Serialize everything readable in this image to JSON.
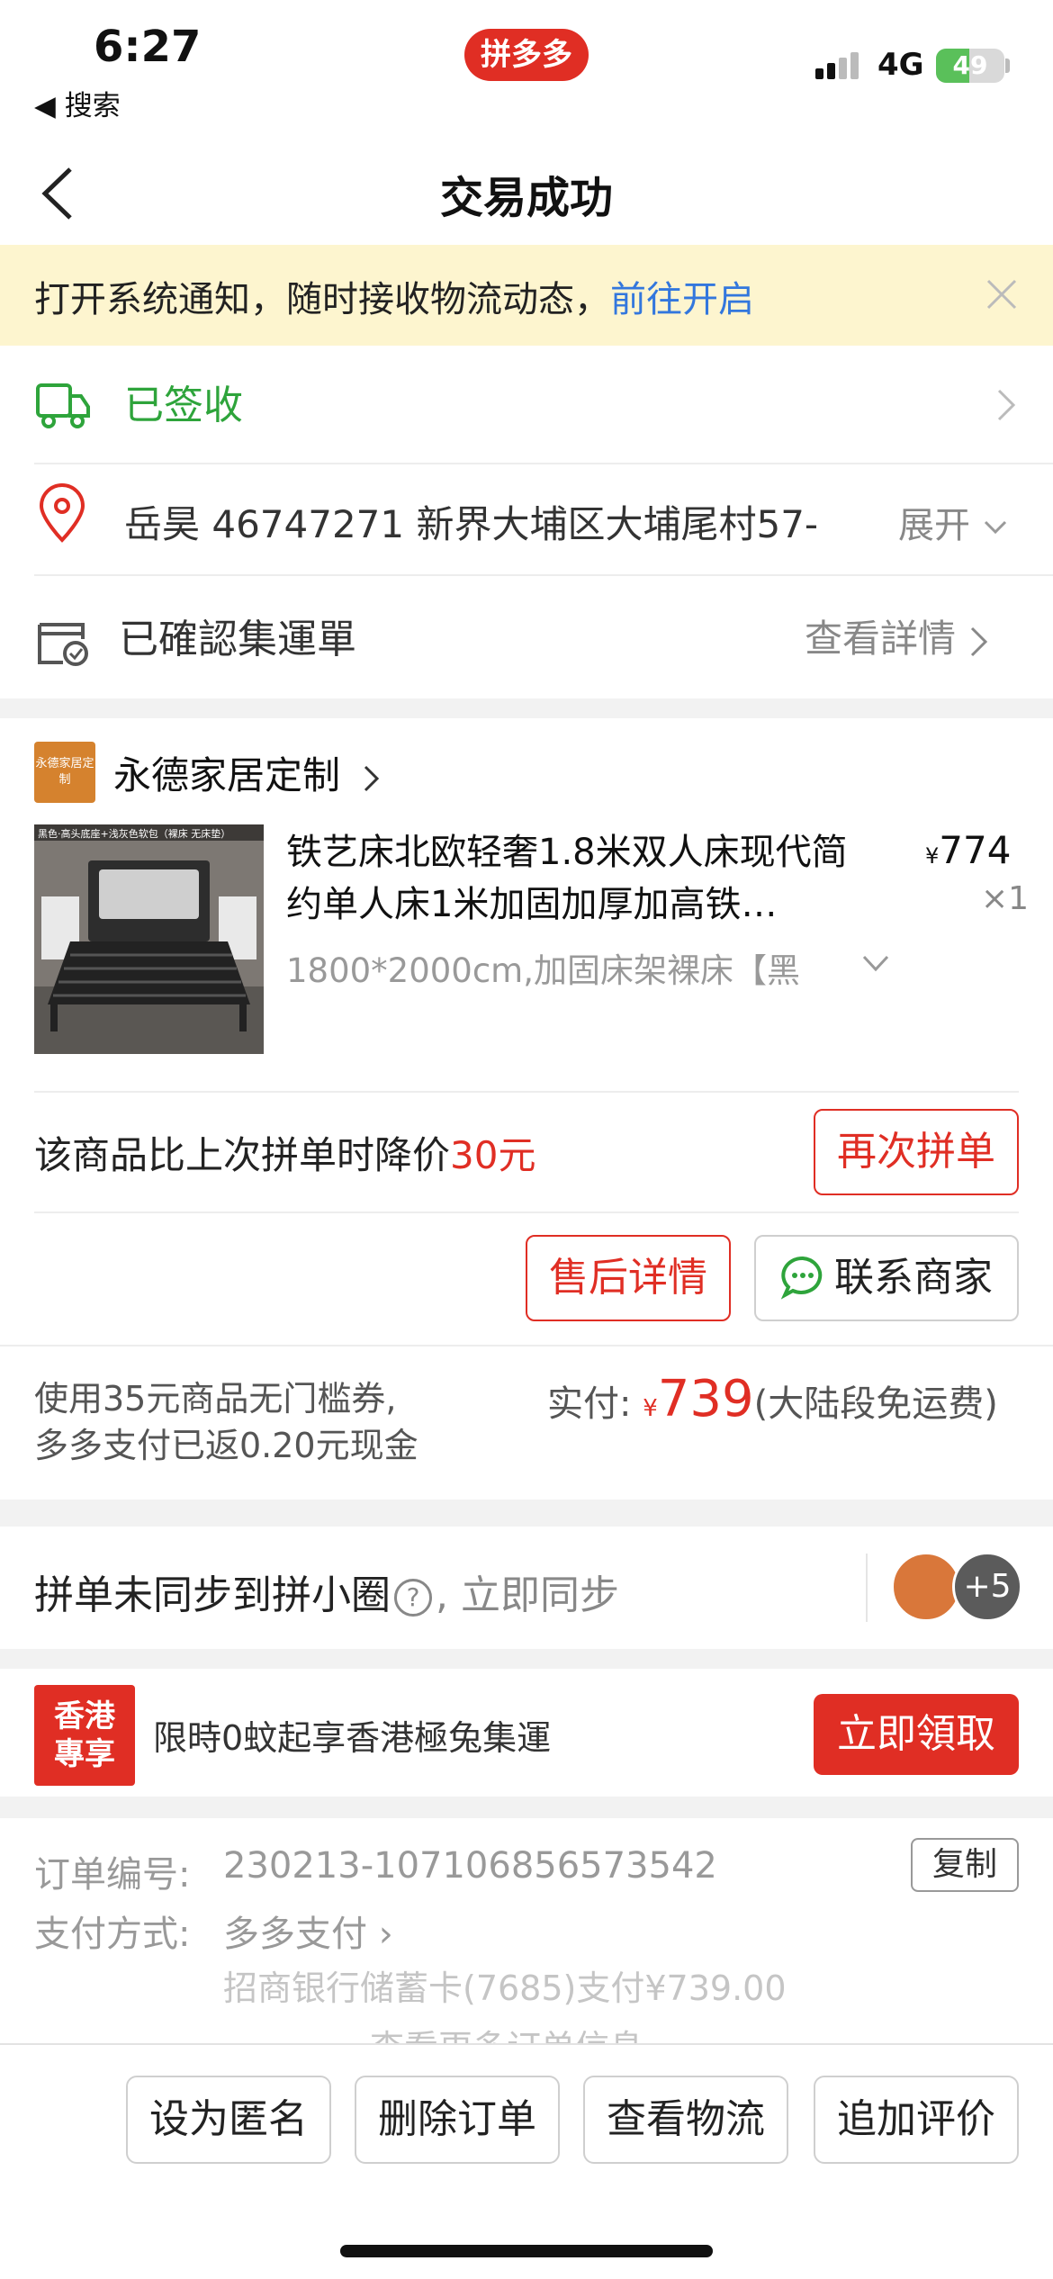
{
  "status_bar": {
    "time": "6:27",
    "back_app": "◀ 搜索",
    "app_logo": "拼多多",
    "network": "4G",
    "battery": "49",
    "battery_level": 0.49
  },
  "nav": {
    "title": "交易成功"
  },
  "notice": {
    "text": "打开系统通知，随时接收物流动态，",
    "link": "前往开启"
  },
  "order_status": {
    "status": "已签收",
    "address": "岳昊  46747271  新界大埔区大埔尾村57-",
    "expand": "展开",
    "consolidation": "已確認集運單",
    "details": "查看詳情"
  },
  "store": {
    "logo_text": "永德家居定制",
    "name": "永德家居定制"
  },
  "product": {
    "image_caption": "黑色·高头底座+浅灰色软包（裸床 无床垫）",
    "title": "铁艺床北欧轻奢1.8米双人床现代简约单人床1米加固加厚加高铁…",
    "price_symbol": "¥",
    "price": "774",
    "qty": "×1",
    "spec": "1800*2000cm,加固床架裸床【黑"
  },
  "price_drop": {
    "text": "该商品比上次拼单时降价",
    "amount": "30元",
    "rebuy": "再次拼单"
  },
  "actions": {
    "after_sale": "售后详情",
    "contact": "联系商家"
  },
  "payment": {
    "note_line1": "使用35元商品无门槛券,",
    "note_line2": "多多支付已返0.20元现金",
    "paid_label": "实付: ",
    "paid_symbol": "¥",
    "paid_amount": "739",
    "shipping": "(大陆段免运费)"
  },
  "sync": {
    "text": "拼单未同步到拼小圈",
    "help": "?",
    "action": ", 立即同步",
    "more_count": "+5"
  },
  "promo": {
    "badge_line1": "香港",
    "badge_line2": "專享",
    "text": "限時0蚊起享香港極兔集運",
    "button": "立即領取"
  },
  "order_info": {
    "number_label": "订单编号:",
    "number": "230213-107106856573542",
    "copy": "复制",
    "pay_label": "支付方式:",
    "pay_method": "多多支付 ›",
    "bank": "招商银行储蓄卡(7685)支付¥739.00",
    "more": "查看更多订单信息 ⌄"
  },
  "bottom_bar": {
    "anonymous": "设为匿名",
    "delete": "删除订单",
    "logistics": "查看物流",
    "review": "追加评价"
  },
  "colors": {
    "brand_red": "#e02e24",
    "status_green": "#2ea43b",
    "link_blue": "#3377dd",
    "notice_bg": "#fdf5cf"
  }
}
